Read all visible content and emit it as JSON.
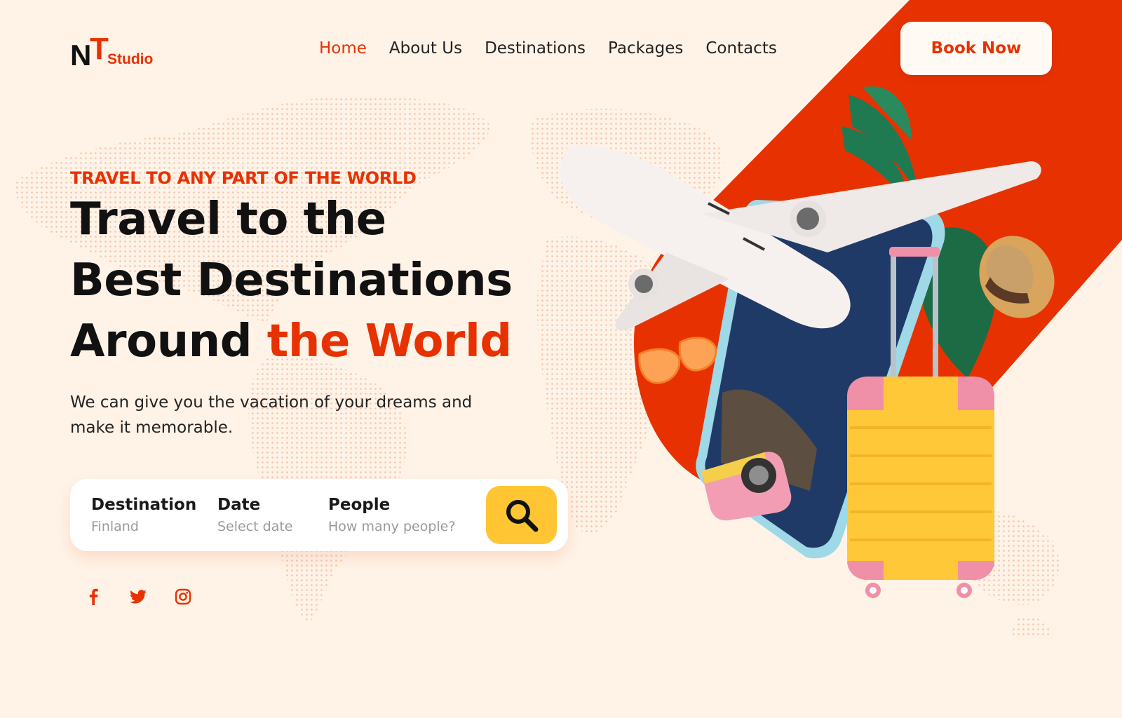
{
  "brand": {
    "logo_n": "N",
    "logo_t": "T",
    "logo_studio": "Studio"
  },
  "nav": {
    "items": [
      {
        "label": "Home",
        "active": true
      },
      {
        "label": "About Us",
        "active": false
      },
      {
        "label": "Destinations",
        "active": false
      },
      {
        "label": "Packages",
        "active": false
      },
      {
        "label": "Contacts",
        "active": false
      }
    ]
  },
  "header": {
    "book_now_label": "Book Now"
  },
  "hero": {
    "eyebrow": "TRAVEL TO ANY PART OF THE WORLD",
    "headline_line1": "Travel to the",
    "headline_line2": "Best Destinations",
    "headline_line3_plain": "Around ",
    "headline_line3_accent": "the World",
    "subtext": "We can give you the vacation of your dreams and make it memorable."
  },
  "search": {
    "destination": {
      "label": "Destination",
      "placeholder": "Finland"
    },
    "date": {
      "label": "Date",
      "placeholder": "Select date"
    },
    "people": {
      "label": "People",
      "placeholder": "How many people?"
    },
    "button_icon": "search-icon"
  },
  "social": {
    "icons": [
      "facebook-icon",
      "twitter-icon",
      "instagram-icon"
    ]
  },
  "colors": {
    "background": "#fff3e8",
    "accent": "#e83100",
    "search_button": "#ffc533",
    "text": "#111111"
  }
}
